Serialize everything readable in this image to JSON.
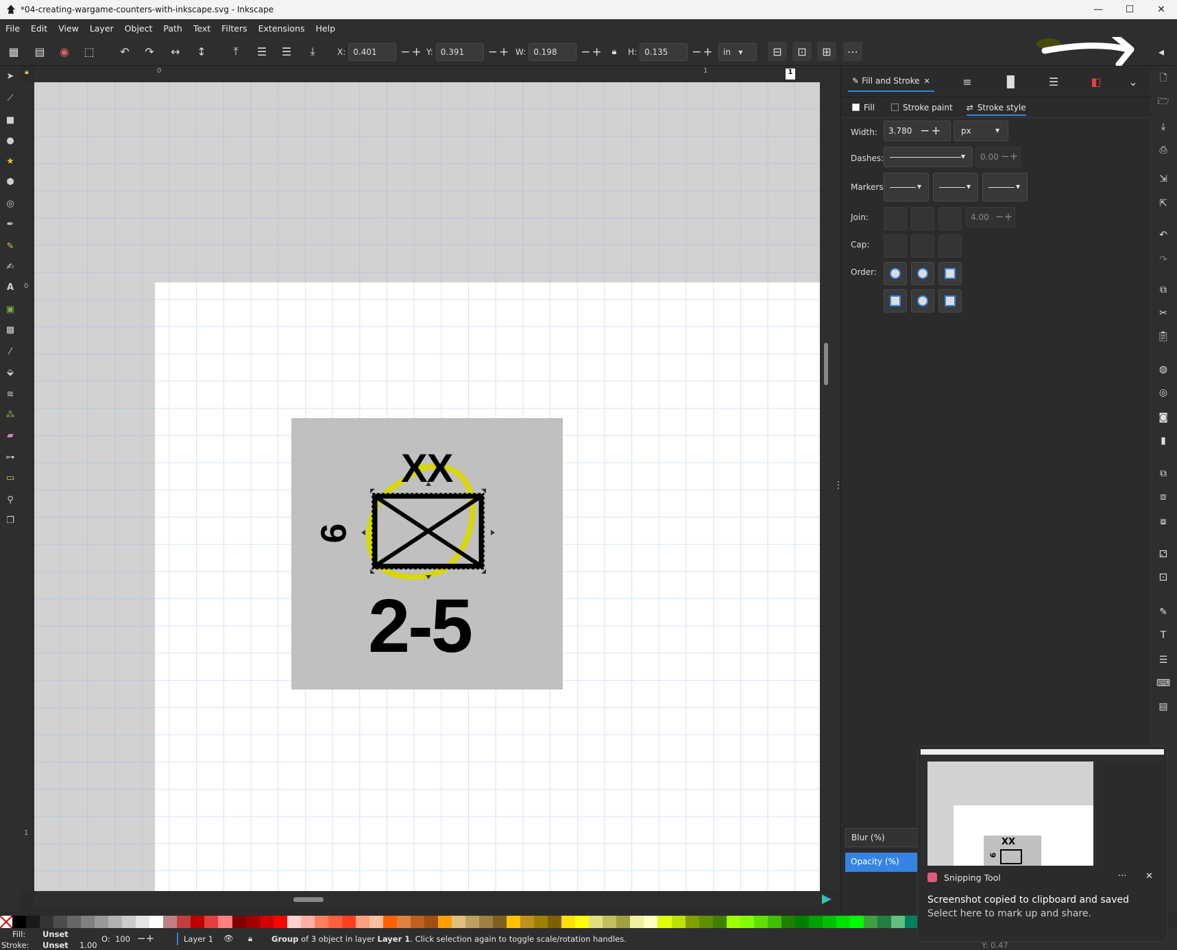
{
  "window": {
    "title": "*04-creating-wargame-counters-with-inkscape.svg - Inkscape",
    "minimize": "—",
    "maximize": "☐",
    "close": "✕"
  },
  "menu": [
    "File",
    "Edit",
    "View",
    "Layer",
    "Object",
    "Path",
    "Text",
    "Filters",
    "Extensions",
    "Help"
  ],
  "coords": {
    "x_label": "X:",
    "x": "0.401",
    "y_label": "Y:",
    "y": "0.391",
    "w_label": "W:",
    "w": "0.198",
    "h_label": "H:",
    "h": "0.135",
    "unit": "in"
  },
  "ruler": {
    "top": [
      "0",
      "1"
    ],
    "left": [
      "0",
      "1"
    ]
  },
  "counter": {
    "top_symbol": "XX",
    "side_number": "6",
    "strength": "2-5"
  },
  "dock": {
    "tab_title": "Fill and Stroke",
    "tab_close": "✕",
    "subtabs": [
      "Fill",
      "Stroke paint",
      "Stroke style"
    ],
    "width_label": "Width:",
    "width_value": "3.780",
    "width_unit": "px",
    "dashes_label": "Dashes:",
    "dashes_value": "0.00",
    "markers_label": "Markers:",
    "join_label": "Join:",
    "join_value": "4.00",
    "cap_label": "Cap:",
    "order_label": "Order:",
    "blur_label": "Blur (%)",
    "opacity_label": "Opacity (%)"
  },
  "status": {
    "fill_label": "Fill:",
    "fill_value": "Unset",
    "stroke_label": "Stroke:",
    "stroke_value": "Unset",
    "stroke_width": "1.00",
    "opacity_label": "O:",
    "opacity_value": "100",
    "layer": "Layer 1",
    "message_pre": "Group",
    "message_mid": " of 3 object in layer ",
    "message_layer": "Layer 1",
    "message_post": ". Click selection again to toggle scale/rotation handles.",
    "y_readout": "Y:  0.47"
  },
  "toast": {
    "app": "Snipping Tool",
    "more": "···",
    "close": "✕",
    "line1": "Screenshot copied to clipboard and saved",
    "line2": "Select here to mark up and share.",
    "thumb_symbol": "XX",
    "thumb_number": "6"
  },
  "colors": {
    "accent": "#3584e4",
    "highlight": "#d8d800",
    "palette": [
      "#000000",
      "#1a1a1a",
      "#333333",
      "#4d4d4d",
      "#666666",
      "#808080",
      "#999999",
      "#b3b3b3",
      "#cccccc",
      "#e6e6e6",
      "#ffffff",
      "#c08080",
      "#c04040",
      "#c00000",
      "#e04040",
      "#ff8080",
      "#800000",
      "#a00000",
      "#d00000",
      "#ff0000",
      "#ffd0d0",
      "#ffb0a0",
      "#ff8060",
      "#ff6040",
      "#ff4020",
      "#ffa080",
      "#ffc0a0",
      "#ff6000",
      "#e08040",
      "#c06020",
      "#a05010",
      "#ffa000",
      "#e0c080",
      "#c0a060",
      "#a08040",
      "#806020",
      "#ffc000",
      "#c09020",
      "#a08000",
      "#806000",
      "#ffe000",
      "#ffff00",
      "#e0e080",
      "#c0c060",
      "#a0a040",
      "#f0f0a0",
      "#ffffc0",
      "#e0ff00",
      "#c0e000",
      "#80a000",
      "#609000",
      "#408000",
      "#a0ff00",
      "#80ff00",
      "#60e000",
      "#40c000",
      "#208000",
      "#008000",
      "#00a000",
      "#00c000",
      "#00e000",
      "#00ff00",
      "#40a040",
      "#208040",
      "#60c080",
      "#008060"
    ]
  }
}
